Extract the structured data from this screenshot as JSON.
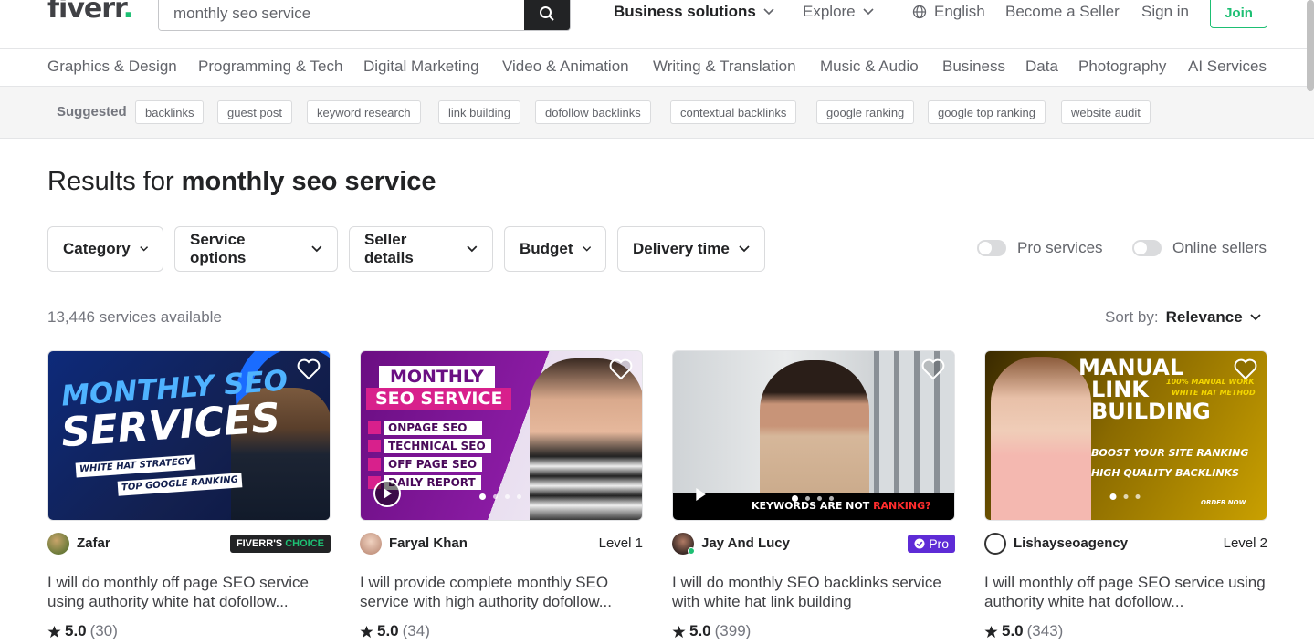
{
  "header": {
    "logo": "fiverr",
    "logo_dot": ".",
    "search_value": "monthly seo service",
    "nav": {
      "business": "Business solutions",
      "explore": "Explore",
      "language": "English",
      "become_seller": "Become a Seller",
      "sign_in": "Sign in",
      "join": "Join"
    }
  },
  "categories": [
    "Graphics & Design",
    "Programming & Tech",
    "Digital Marketing",
    "Video & Animation",
    "Writing & Translation",
    "Music & Audio",
    "Business",
    "Data",
    "Photography",
    "AI Services"
  ],
  "suggested": {
    "label": "Suggested",
    "chips": [
      "backlinks",
      "guest post",
      "keyword research",
      "link building",
      "dofollow backlinks",
      "contextual backlinks",
      "google ranking",
      "google top ranking",
      "website audit"
    ]
  },
  "results": {
    "prefix": "Results for",
    "query": "monthly seo service",
    "count": "13,446 services available",
    "sort_label": "Sort by:",
    "sort_value": "Relevance"
  },
  "filters": [
    "Category",
    "Service options",
    "Seller details",
    "Budget",
    "Delivery time"
  ],
  "toggles": {
    "pro": "Pro services",
    "online": "Online sellers"
  },
  "gigs": [
    {
      "seller": "Zafar",
      "badge_fc_a": "FIVERR'S",
      "badge_fc_b": "CHOICE",
      "title": "I will do monthly off page SEO service using authority white hat dofollow...",
      "rating": "5.0",
      "reviews": "(30)",
      "thumb_l1": "MONTHLY SEO",
      "thumb_l2": "SERVICES",
      "thumb_t1": "WHITE HAT STRATEGY",
      "thumb_t2": "TOP GOOGLE RANKING"
    },
    {
      "seller": "Faryal Khan",
      "level": "Level 1",
      "title": "I will provide complete monthly SEO service with high authority dofollow...",
      "rating": "5.0",
      "reviews": "(34)",
      "thumb_l1": "MONTHLY",
      "thumb_l2": "SEO SERVICE",
      "thumb_items": [
        "ONPAGE SEO",
        "TECHNICAL SEO",
        "OFF PAGE SEO",
        "DAILY REPORT"
      ]
    },
    {
      "seller": "Jay And Lucy",
      "badge_pro": "Pro",
      "title": "I will do monthly SEO backlinks service with white hat link building",
      "rating": "5.0",
      "reviews": "(399)",
      "thumb_caption_a": "KEYWORDS ARE NOT",
      "thumb_caption_b": "RANKING?"
    },
    {
      "seller": "Lishayseoagency",
      "level": "Level 2",
      "title": "I will monthly off page SEO service using authority white hat dofollow...",
      "rating": "5.0",
      "reviews": "(343)",
      "thumb_l1": "MANUAL",
      "thumb_l2": "LINK",
      "thumb_l3": "BUILDING",
      "thumb_side1": "100% MANUAL WORK",
      "thumb_side2": "WHITE HAT METHOD",
      "thumb_b1": "BOOST YOUR SITE RANKING",
      "thumb_b2": "HIGH QUALITY BACKLINKS",
      "thumb_order": "ORDER NOW"
    }
  ],
  "colors": {
    "brand_green": "#1dbf73",
    "pro_purple": "#5e2bd6",
    "text_dark": "#222325",
    "text_muted": "#62646a"
  }
}
